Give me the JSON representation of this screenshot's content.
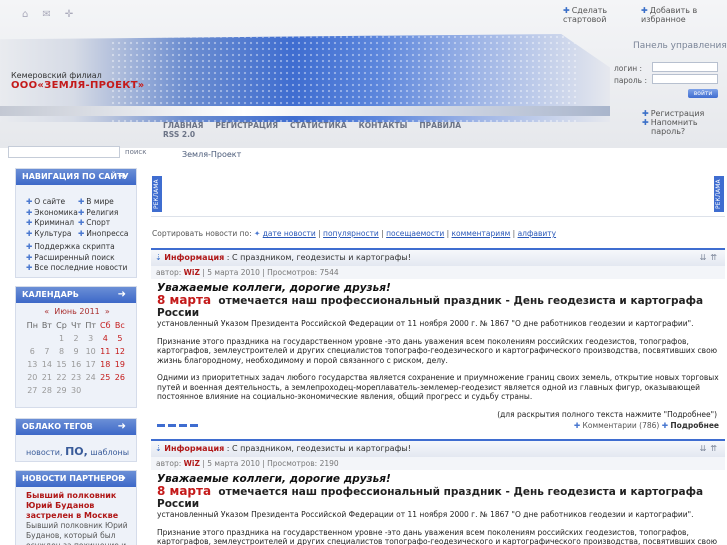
{
  "header": {
    "logo_top": "Кемеровский филиал",
    "logo_main": "ООО«ЗЕМЛЯ-ПРОЕКТ»",
    "fav_start": "Сделать стартовой",
    "fav_add": "Добавить в избранное",
    "panel_title": "Панель управления",
    "login_label": "логин :",
    "password_label": "пароль :",
    "login_button": "войти",
    "register": "Регистрация",
    "remind": "Напомнить пароль?",
    "nav": [
      "ГЛАВНАЯ",
      "РЕГИСТРАЦИЯ",
      "СТАТИСТИКА",
      "КОНТАКТЫ",
      "ПРАВИЛА"
    ],
    "rss": "RSS 2.0"
  },
  "search": {
    "button": "поиск",
    "placeholder": ""
  },
  "breadcrumb": "Земля-Проект",
  "sidebar": {
    "nav_title": "НАВИГАЦИЯ ПО САЙТУ",
    "nav_left": [
      "О сайте",
      "Экономика",
      "Криминал",
      "Культура"
    ],
    "nav_right": [
      "В мире",
      "Религия",
      "Спорт",
      "Инопресса"
    ],
    "nav_extra": [
      "Поддержка скрипта",
      "Расширенный поиск",
      "Все последние новости"
    ],
    "calendar_title": "КАЛЕНДАРЬ",
    "calendar_month": "Июнь 2011",
    "calendar_prev": "«",
    "calendar_next": "»",
    "weekdays": [
      "Пн",
      "Вт",
      "Ср",
      "Чт",
      "Пт",
      "Сб",
      "Вс"
    ],
    "weeks": [
      [
        "",
        "",
        "1",
        "2",
        "3",
        "4",
        "5"
      ],
      [
        "6",
        "7",
        "8",
        "9",
        "10",
        "11",
        "12"
      ],
      [
        "13",
        "14",
        "15",
        "16",
        "17",
        "18",
        "19"
      ],
      [
        "20",
        "21",
        "22",
        "23",
        "24",
        "25",
        "26"
      ],
      [
        "27",
        "28",
        "29",
        "30",
        "",
        "",
        ""
      ]
    ],
    "tags_title": "ОБЛАКО ТЕГОВ",
    "tags": [
      "новости,",
      "ПО,",
      "шаблоны"
    ],
    "partners_title": "НОВОСТИ ПАРТНЕРОВ",
    "partner_headline": "Бывший полковник Юрий Буданов застрелен в Москве",
    "partner_text": "Бывший полковник Юрий Буданов, который был осужден за похищение и"
  },
  "main": {
    "ad_label": "РЕКЛАМА",
    "sort_label": "Сортировать новости по:",
    "sort_options": [
      "дате новости",
      "популярности",
      "посещаемости",
      "комментариям",
      "алфавиту"
    ],
    "articles": [
      {
        "category": "Информация",
        "title": "С праздником, геодезисты и картографы!",
        "author_label": "автор:",
        "author": "WiZ",
        "date": "5 марта 2010",
        "views": "Просмотров: 7544",
        "greeting": "Уважаемые коллеги, дорогие друзья!",
        "hl_date": "8 марта",
        "hl_text": "отмечается наш профессиональный праздник  - День геодезиста и картографа России",
        "decree": "установленный Указом Президента Российской Федерации от 11 ноября 2000 г. № 1867 \"О дне работников геодезии и картографии\".",
        "para1": "Признание этого праздника на государственном уровне  -это дань уважения всем поколениям российских геодезистов, топографов, картографов, землеустроителей и других специалистов топографо-геодезического и картографического производства, посвятивших свою жизнь благородному, необходимому и порой связанного с риском, делу.",
        "para2": "Одними из приоритетных задач любого государства является сохранение и приумножение границ своих земель, открытие новых торговых путей и военная деятельность, а землепроходец-мореплаватель-землемер-геодезист является одной из главных фигур, оказывающей постоянное влияние на социально-экономические явления, общий прогресс и судьбу страны.",
        "more": "(для раскрытия полного текста нажмите \"Подробнее\")",
        "comments": "Комментарии (786)",
        "details": "Подробнее"
      },
      {
        "category": "Информация",
        "title": "С праздником, геодезисты и картографы!",
        "author_label": "автор:",
        "author": "WiZ",
        "date": "5 марта 2010",
        "views": "Просмотров: 2190",
        "greeting": "Уважаемые коллеги, дорогие друзья!",
        "hl_date": "8 марта",
        "hl_text": "отмечается наш профессиональный праздник  - День геодезиста и картографа России",
        "decree": "установленный Указом Президента Российской Федерации от 11 ноября 2000 г. № 1867 \"О дне работников геодезии и картографии\".",
        "para1": "Признание этого праздника на государственном уровне  -это дань уважения всем поколениям российских геодезистов, топографов, картографов, землеустроителей и других специалистов топографо-геодезического и картографического производства, посвятивших свою жизнь благородному, необходимому и порой связанного с риском, делу."
      }
    ]
  }
}
